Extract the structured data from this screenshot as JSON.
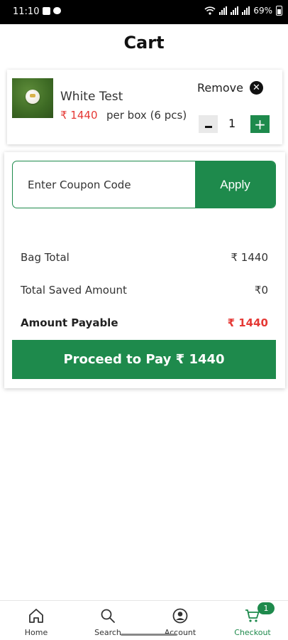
{
  "status_bar": {
    "time": "11:10",
    "battery": "69%"
  },
  "page": {
    "title": "Cart"
  },
  "cart_item": {
    "name": "White Test",
    "price": "₹ 1440",
    "unit": "per box (6 pcs)",
    "remove_label": "Remove",
    "quantity": "1",
    "minus_label": "-",
    "plus_label": "+"
  },
  "coupon": {
    "placeholder": "Enter Coupon Code",
    "apply_label": "Apply"
  },
  "summary": {
    "bag_total_label": "Bag Total",
    "bag_total_value": "₹ 1440",
    "saved_label": "Total Saved Amount",
    "saved_value": "₹0",
    "payable_label": "Amount Payable",
    "payable_value": "₹ 1440"
  },
  "pay_button": {
    "label": "Proceed to Pay ₹ 1440"
  },
  "bottom_nav": {
    "items": [
      {
        "label": "Home",
        "icon": "home-icon"
      },
      {
        "label": "Search",
        "icon": "search-icon"
      },
      {
        "label": "Account",
        "icon": "account-icon"
      },
      {
        "label": "Checkout",
        "icon": "cart-icon",
        "badge": "1"
      }
    ]
  },
  "colors": {
    "primary": "#1e8a4c",
    "price": "#e53935"
  }
}
